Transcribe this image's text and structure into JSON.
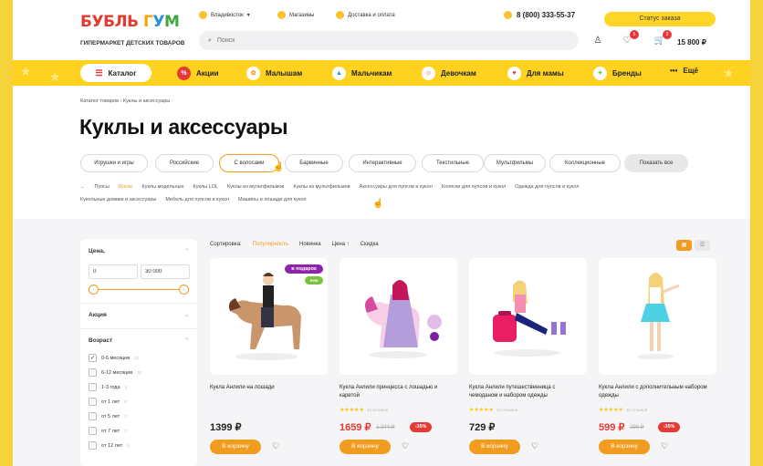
{
  "header": {
    "logo_text": "БУБЛЬ ГУМ",
    "logo_sub": "ГИПЕРМАРКЕТ ДЕТСКИХ ТОВАРОВ",
    "city": "Владивосток",
    "stores": "Магазины",
    "delivery": "Доставка и оплата",
    "phone": "8 (800) 333-55-37",
    "order_status": "Статус заказа",
    "search_placeholder": "Поиск",
    "fav_count": "5",
    "cart_count": "2",
    "cart_sum": "15 800 ₽"
  },
  "nav": {
    "catalog": "Каталог",
    "items": [
      "Акции",
      "Малышам",
      "Мальчикам",
      "Девочкам",
      "Для мамы",
      "Бренды",
      "Ещё"
    ]
  },
  "breadcrumb": [
    "Каталог товаров",
    "›",
    "Куклы и аксессуары"
  ],
  "title": "Куклы и аксессуары",
  "chips": [
    "Игрушки и игры",
    "Российские",
    "С волосами",
    "Барвинные",
    "Интерактивные",
    "Текстильные",
    "Мультфильмы",
    "Коллекционные",
    "Показать все"
  ],
  "tags_row1": [
    "←",
    "Пупсы",
    "Куклы",
    "Куклы модельные",
    "Куклы LOL",
    "Куклы из мультфильмов",
    "Куклы из мультфильмов",
    "Аксессуары для пупсов и кукол",
    "Коляски для пупсов и кукол",
    "Одежда для пупсов и кукол"
  ],
  "tags_row2": [
    "Кукольные домики и аксессуары",
    "Мебель для пупсов и кукол",
    "Машины и лошади для кукол"
  ],
  "filters": {
    "price_title": "Цена,",
    "price_from": "0",
    "price_to": "30 000",
    "stock_title": "Акция",
    "age_title": "Возраст",
    "ages": [
      {
        "label": "0-6 месяцев",
        "count": "21",
        "checked": true
      },
      {
        "label": "6-12 месяцев",
        "count": "32",
        "checked": false
      },
      {
        "label": "1-3 года",
        "count": "4",
        "checked": false
      },
      {
        "label": "от 1 лет",
        "count": "8",
        "checked": false
      },
      {
        "label": "от 5 лет",
        "count": "3",
        "checked": false
      },
      {
        "label": "от 7 лет",
        "count": "3",
        "checked": false
      },
      {
        "label": "от 12 лет",
        "count": "4",
        "checked": false
      }
    ]
  },
  "sort": {
    "label": "Сортировка:",
    "options": [
      "Популярность",
      "Новинка",
      "Цена ↑",
      "Скидка"
    ]
  },
  "products": [
    {
      "name": "Кукла Анлили на лошади",
      "price": "1399 ₽",
      "old": "",
      "discount": "",
      "reviews": "",
      "gift": "в подарок",
      "new": "new",
      "buy": "В корзину"
    },
    {
      "name": "Кукла Анлили принцесса с лошадью и каретой",
      "price": "1659 ₽",
      "old": "1 244 ₽",
      "discount": "-35%",
      "reviews": "13 отзывов",
      "gift": "",
      "new": "",
      "buy": "В корзину"
    },
    {
      "name": "Кукла Анлили путешественница с чемоданом и набором одежды",
      "price": "729 ₽",
      "old": "",
      "discount": "",
      "reviews": "13 отзывов",
      "gift": "",
      "new": "",
      "buy": "В корзину"
    },
    {
      "name": "Кукла Анлили с дополнительным набором одежды",
      "price": "599 ₽",
      "old": "299 ₽",
      "discount": "-35%",
      "reviews": "13 отзывов",
      "gift": "",
      "new": "",
      "buy": "В корзину"
    }
  ],
  "colors": {
    "accent": "#f29c1f",
    "brand_yellow": "#ffd21f",
    "sale_red": "#e53935"
  }
}
